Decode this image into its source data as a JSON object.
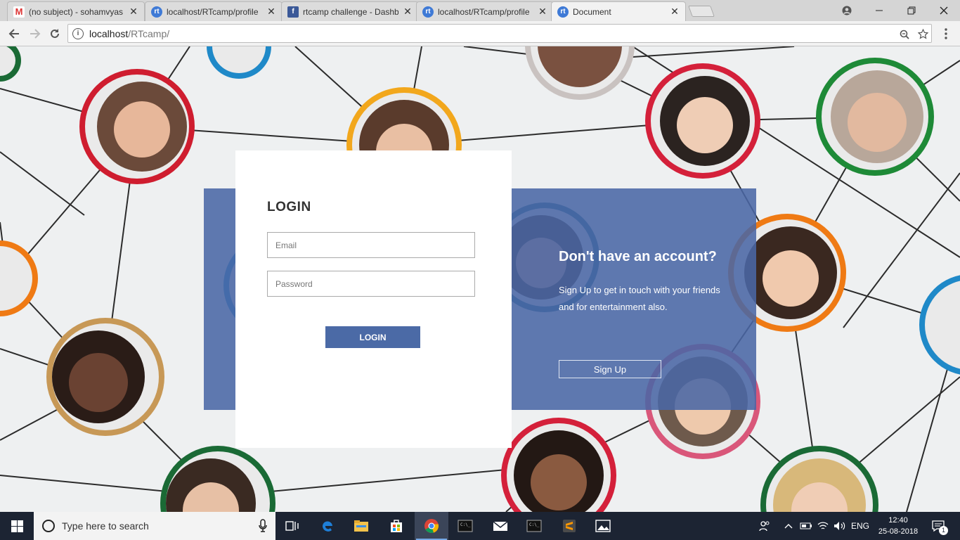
{
  "browser": {
    "tabs": [
      {
        "favicon": "gmail-icon",
        "title": "(no subject) - sohamvyas"
      },
      {
        "favicon": "rtcamp-icon",
        "title": "localhost/RTcamp/profile"
      },
      {
        "favicon": "facebook-icon",
        "title": "rtcamp challenge - Dashb"
      },
      {
        "favicon": "rtcamp-icon",
        "title": "localhost/RTcamp/profile"
      },
      {
        "favicon": "rtcamp-icon",
        "title": "Document",
        "active": true
      }
    ],
    "close_glyph": "✕",
    "address": {
      "host": "localhost",
      "path": "/RTcamp/"
    }
  },
  "login": {
    "title": "LOGIN",
    "email_placeholder": "Email",
    "password_placeholder": "Password",
    "button_label": "LOGIN"
  },
  "signup": {
    "title": "Don't have an account?",
    "text": "Sign Up to get in touch with your friends and for entertainment also.",
    "button_label": "Sign Up"
  },
  "taskbar": {
    "search_placeholder": "Type here to search",
    "language": "ENG",
    "time": "12:40",
    "date": "25-08-2018",
    "notification_count": "1"
  },
  "colors": {
    "panel_blue": "#4a66a5",
    "login_button": "#4b6aa6",
    "taskbar": "#1c2433"
  }
}
